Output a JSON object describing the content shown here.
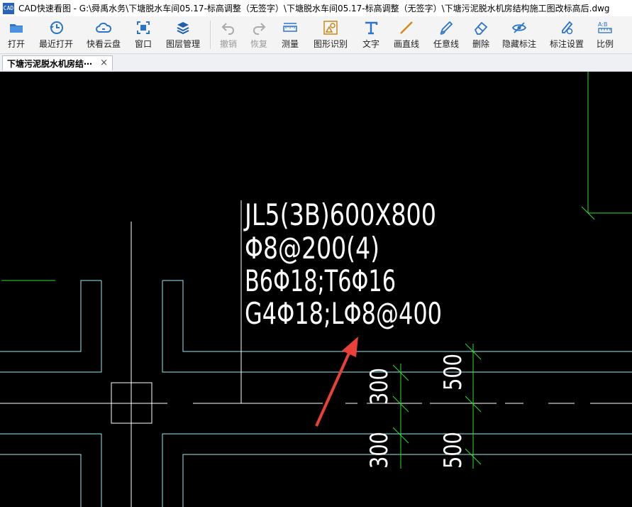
{
  "window": {
    "app_icon_label": "CAD",
    "title": "CAD快速看图 - G:\\舜禹水务\\下塘脱水车间05.17-标高调整（无签字）\\下塘脱水车间05.17-标高调整（无签字）\\下塘污泥脱水机房结构施工图改标高后.dwg"
  },
  "toolbar": {
    "open": "打开",
    "recent": "最近打开",
    "cloud": "快看云盘",
    "window": "窗口",
    "layers": "图层管理",
    "undo": "撤销",
    "redo": "恢复",
    "measure": "测量",
    "recognize": "图形识别",
    "text": "文字",
    "line": "画直线",
    "freeline": "任意线",
    "delete": "删除",
    "hide_dims": "隐藏标注",
    "dim_settings": "标注设置",
    "scale": "比例"
  },
  "tabs": {
    "active_label": "下塘污泥脱水机房结⋯",
    "close_glyph": "×"
  },
  "drawing": {
    "line1": "JL5(3B)600X800",
    "line2": "Φ8@200(4)",
    "line3": "B6Φ18;T6Φ16",
    "line4": "G4Φ18;LΦ8@400",
    "dim_300_upper": "300",
    "dim_300_lower": "300",
    "dim_500_upper": "500",
    "dim_500_lower": "500"
  },
  "colors": {
    "canvas_bg": "#000000",
    "beam_lines": "#9ee8f0",
    "white_lines": "#ffffff",
    "dim_green": "#33dd33",
    "arrow_red": "#e8413a",
    "toolbar_icon_blue": "#2b74c8"
  }
}
